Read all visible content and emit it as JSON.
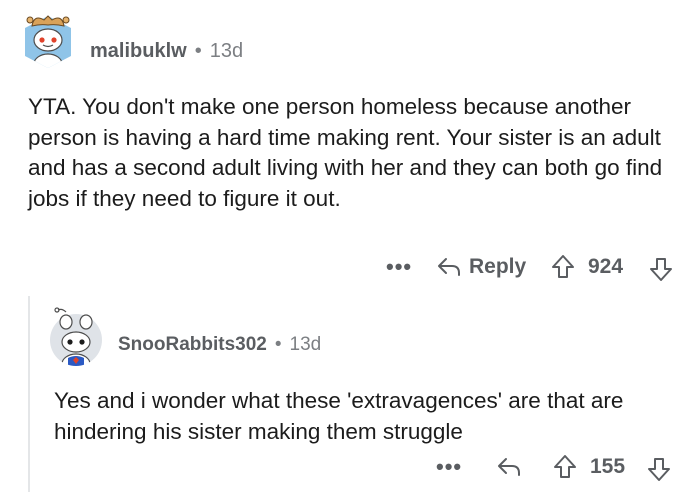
{
  "comment": {
    "username": "malibuklw",
    "separator": "•",
    "age": "13d",
    "body": "YTA. You don't make one person homeless because another person is having a hard time making rent. Your sister is an adult and has a second adult living with her and they can both go find jobs if they need to figure it out.",
    "more_label": "•••",
    "reply_label": "Reply",
    "score": "924",
    "avatar_icon": "snoo-avatar-icon",
    "upvote_icon": "upvote-arrow-icon",
    "downvote_icon": "downvote-arrow-icon",
    "reply_icon": "reply-arrow-icon"
  },
  "reply": {
    "username": "SnooRabbits302",
    "separator": "•",
    "age": "13d",
    "body": "Yes and i wonder what these 'extravagences' are that are hindering his sister making them struggle",
    "more_label": "•••",
    "score": "155",
    "avatar_icon": "snoo-avatar-icon",
    "upvote_icon": "upvote-arrow-icon",
    "downvote_icon": "downvote-arrow-icon",
    "reply_icon": "reply-arrow-icon"
  },
  "colors": {
    "text": "#1c1c1c",
    "meta": "#5a5d61",
    "muted": "#7c7f83",
    "thread_line": "#e4e6e8",
    "avatar1_bg": "#8fc4e8",
    "avatar2_bg": "#dfe3e8"
  }
}
